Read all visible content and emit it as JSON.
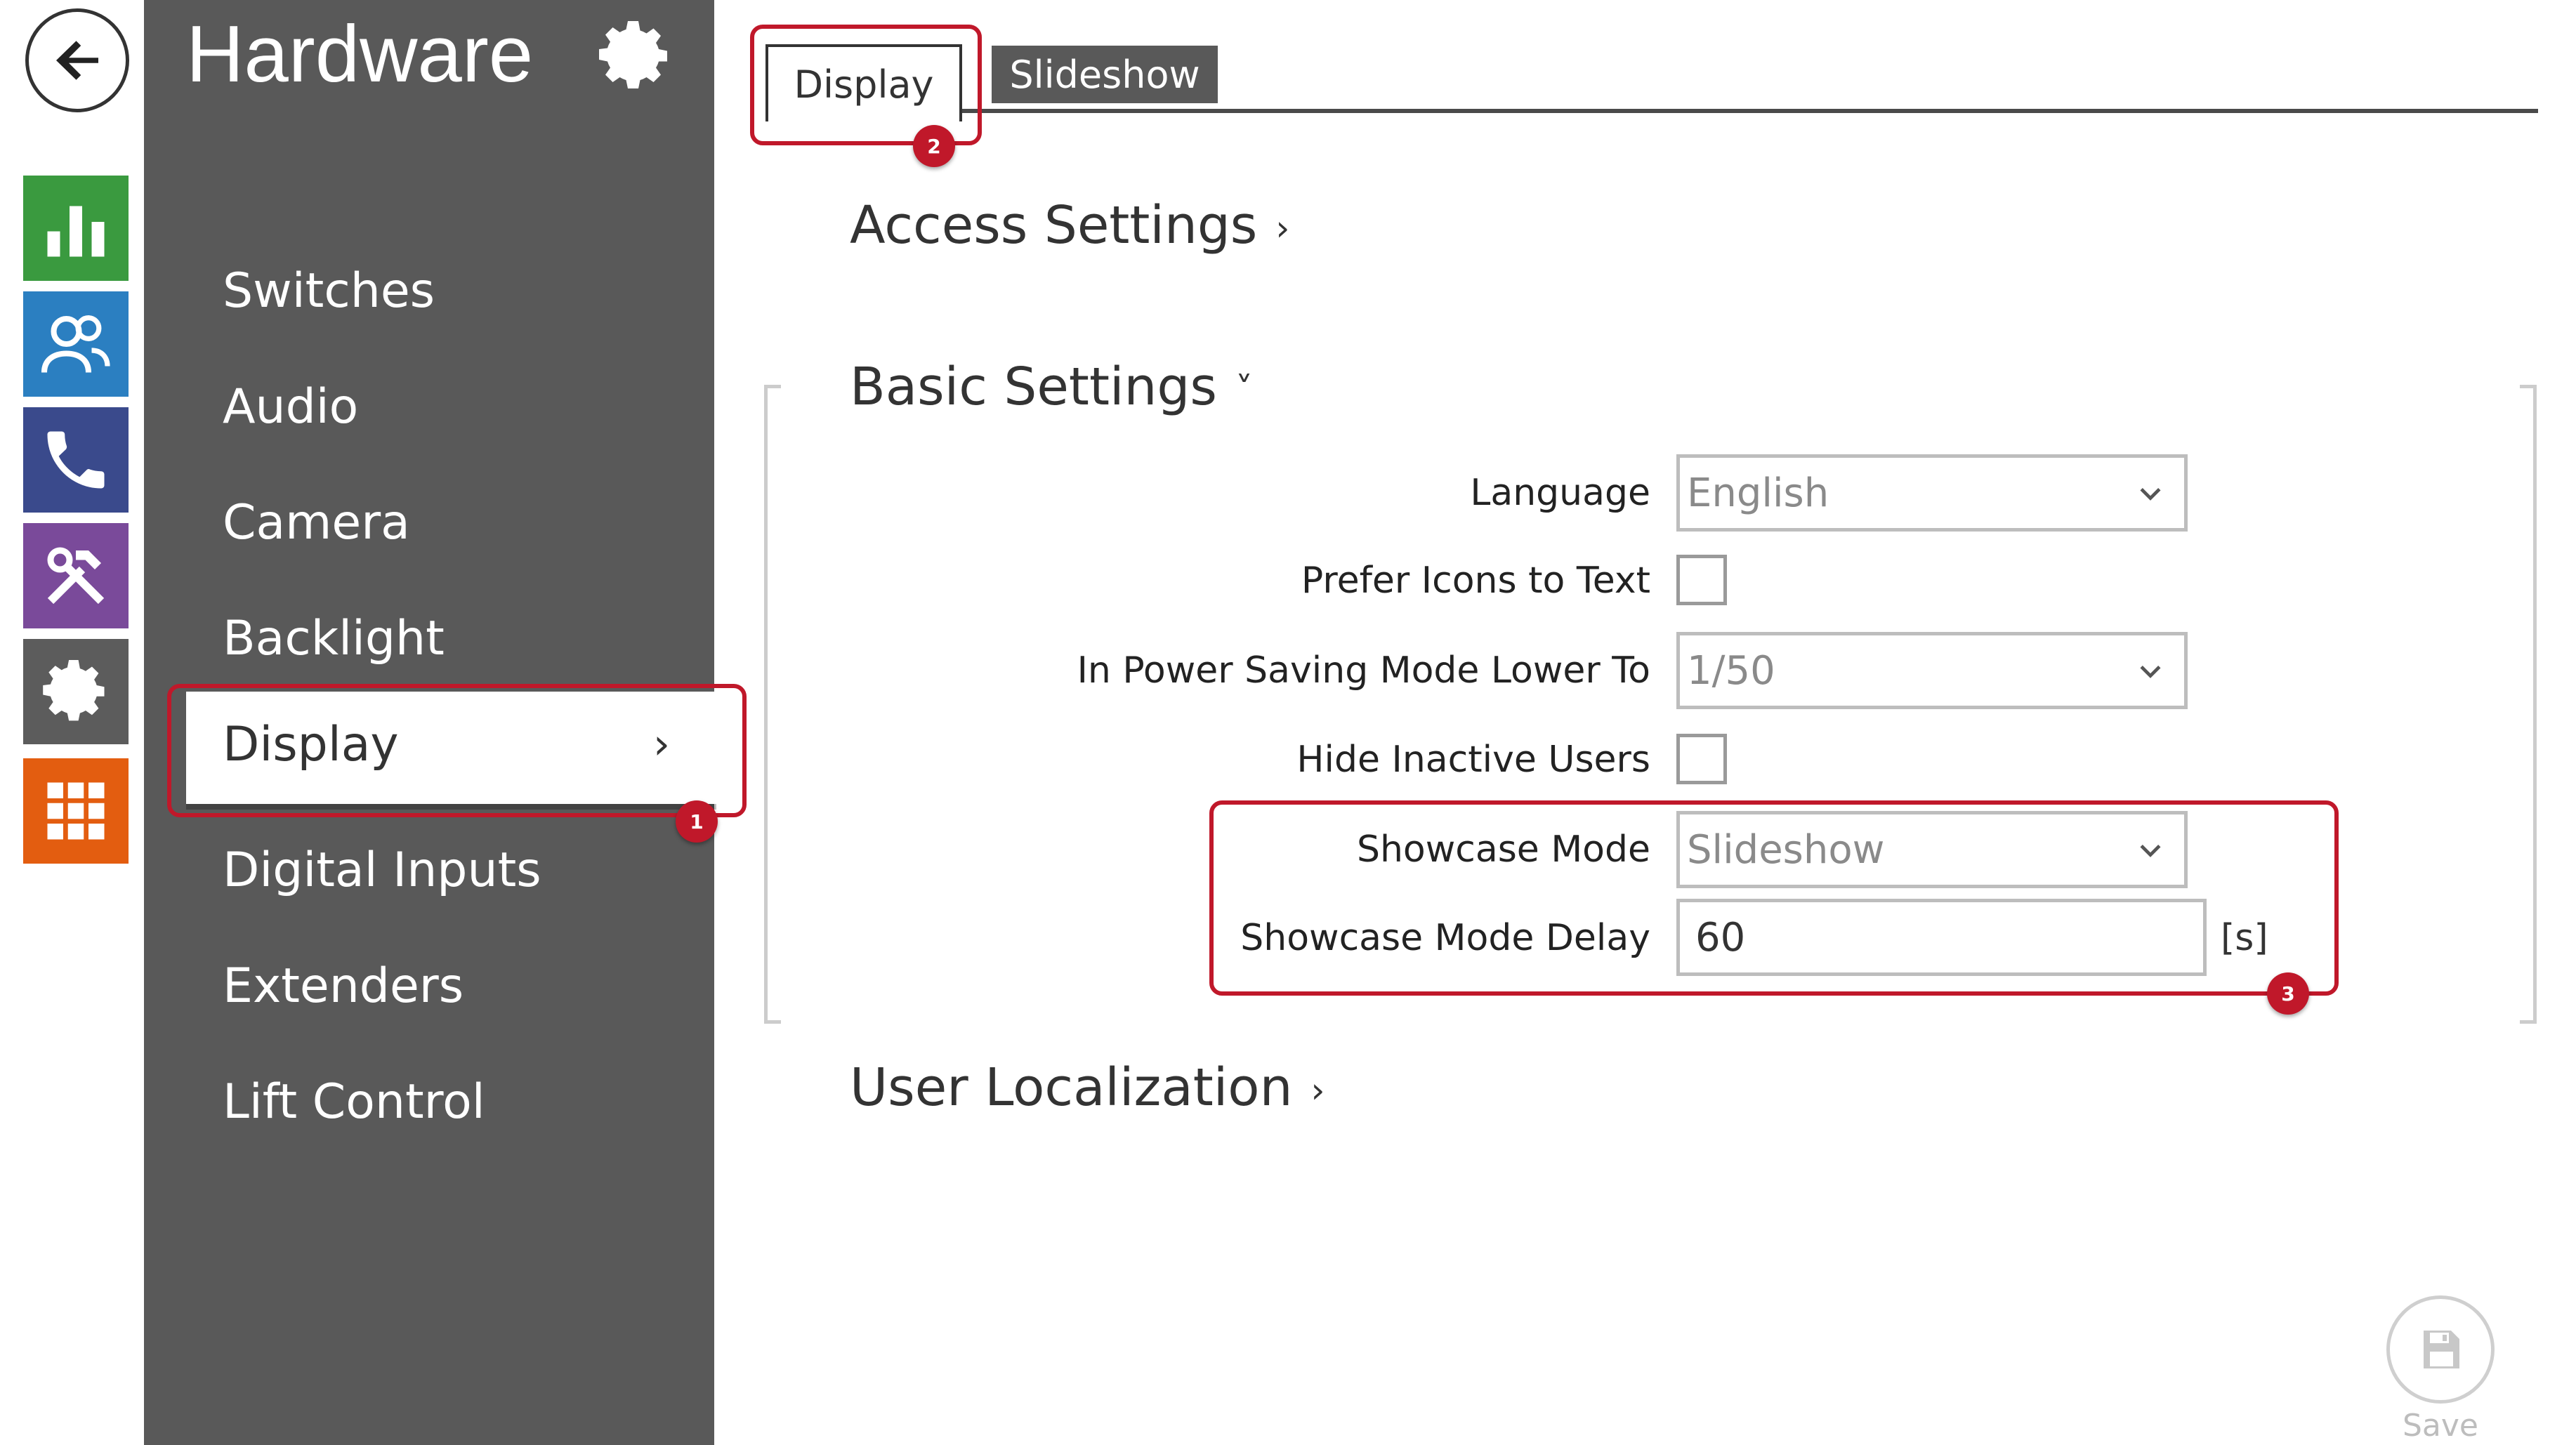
{
  "sidebar": {
    "title": "Hardware",
    "items": [
      {
        "label": "Switches"
      },
      {
        "label": "Audio"
      },
      {
        "label": "Camera"
      },
      {
        "label": "Backlight"
      },
      {
        "label": "Display"
      },
      {
        "label": "Digital Inputs"
      },
      {
        "label": "Extenders"
      },
      {
        "label": "Lift Control"
      }
    ],
    "active_item": "Display"
  },
  "rail": {
    "icons": [
      "back-arrow-icon",
      "status-chart-icon",
      "users-icon",
      "phone-icon",
      "tools-icon",
      "settings-gear-icon",
      "apps-grid-icon"
    ],
    "colors": {
      "green": "#3a9a3f",
      "blue": "#2b7fc1",
      "navy": "#3a4a8c",
      "purple": "#7a4a9a",
      "gray": "#5c5c5c",
      "orange": "#e35d10"
    }
  },
  "tabs": [
    {
      "label": "Display",
      "active": true
    },
    {
      "label": "Slideshow",
      "active": false
    }
  ],
  "sections": {
    "access_settings": {
      "title": "Access Settings",
      "state": "collapsed"
    },
    "basic_settings": {
      "title": "Basic Settings",
      "state": "expanded"
    },
    "user_localization": {
      "title": "User Localization",
      "state": "collapsed"
    }
  },
  "fields": {
    "language": {
      "label": "Language",
      "value": "English"
    },
    "prefer_icons": {
      "label": "Prefer Icons to Text",
      "checked": false
    },
    "power_saving": {
      "label": "In Power Saving Mode Lower To",
      "value": "1/50"
    },
    "hide_inactive": {
      "label": "Hide Inactive Users",
      "checked": false
    },
    "showcase_mode": {
      "label": "Showcase Mode",
      "value": "Slideshow"
    },
    "showcase_delay": {
      "label": "Showcase Mode Delay",
      "value": "60",
      "unit": "[s]"
    }
  },
  "callouts": {
    "one": "1",
    "two": "2",
    "three": "3"
  },
  "save": {
    "label": "Save"
  },
  "accent_color": "#c0182a"
}
